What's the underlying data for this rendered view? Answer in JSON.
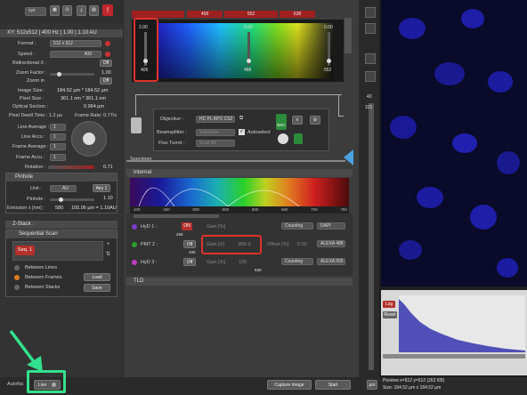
{
  "toolbar": {
    "dropdown": "xyz",
    "red_icon_label": "!"
  },
  "scan_header": {
    "title": "XY: 512x512 | 400 Hz | 1.00 | 1.10 AU"
  },
  "scan": {
    "format_label": "Format :",
    "format_value": "512 x 512",
    "speed_label": "Speed :",
    "speed_value": "400",
    "bidirectional_label": "Bidirectional X :",
    "bidirectional_value": "Off",
    "zoom_factor_label": "Zoom Factor :",
    "zoom_factor_value": "1.00",
    "zoom_in_label": "Zoom in",
    "zoom_in_value": "Off",
    "image_size_label": "Image Size :",
    "image_size_value": "184.52 µm * 184.52 µm",
    "pixel_size_label": "Pixel Size :",
    "pixel_size_value": "361.1 nm * 361.1 nm",
    "optical_section_label": "Optical Section :",
    "optical_section_value": "0.964 µm",
    "pixel_dwell_label": "Pixel Dwell Time : 1.2 µs",
    "frame_rate_label": "Frame Rate: 0.77/s",
    "line_average_label": "Line Average :",
    "line_average_value": "1",
    "line_accu_label": "Line Accu :",
    "line_accu_value": "1",
    "frame_average_label": "Frame Average :",
    "frame_average_value": "1",
    "frame_accu_label": "Frame Accu :",
    "frame_accu_value": "1",
    "rotation_label": "Rotation :",
    "rotation_value": "0.71"
  },
  "pinhole": {
    "title": "Pinhole",
    "unit_label": "Unit :",
    "unit_value": "AU",
    "airy_button": "Airy 1",
    "pinhole_label": "Pinhole :",
    "pinhole_value": "1.10",
    "emission_label": "Emission λ [nm] :",
    "emission_value": "580",
    "emission_info": "105.06 µm = 1.10AU"
  },
  "zstack": {
    "title": "Z-Stack :"
  },
  "sequential": {
    "title": "Sequential Scan",
    "seq_item": "Seq. 1",
    "between_lines": "Between Lines",
    "between_frames": "Between Frames",
    "between_stacks": "Between Stacks",
    "load_button": "Load",
    "save_button": "Save"
  },
  "laser": {
    "tabs": [
      "405",
      "458",
      "552",
      "638"
    ],
    "channels": [
      {
        "value": "2.00",
        "wavelength": "405"
      },
      {
        "value": "0.00",
        "wavelength": "488"
      },
      {
        "value": "0.00",
        "wavelength": "552"
      }
    ]
  },
  "beampath": {
    "objective_label": "Objective :",
    "objective_value": "HC PL APO CS2 63x",
    "beamsplitter_label": "Beamsplitter :",
    "beamsplitter_value": "Substrate",
    "autoselect_label": "Autoselect",
    "fluo_turret_label": "Fluo Turret :",
    "fluo_turret_value": "Scan-BF",
    "bsc_label": "BSC",
    "specimen_label": "Specimen"
  },
  "internal": {
    "title": "Internal",
    "axis_ticks": [
      "400",
      "450",
      "500",
      "550",
      "600",
      "650",
      "700",
      "750"
    ],
    "range_label_1": "415",
    "range_label_2": "465"
  },
  "detectors": [
    {
      "name": "HyD 1 :",
      "state": "ON",
      "gain_label": "Gain [%]",
      "gain_value": "",
      "mode": "Counting",
      "dye": "DAPI",
      "color": "#7a3cc8"
    },
    {
      "name": "PMT 2 :",
      "state": "Off",
      "gain_label": "Gain [V]",
      "gain_value": "800.0",
      "offset_label": "Offset [%]",
      "offset_value": "0.00",
      "dye": "ALEXA 488",
      "color": "#2aa02a"
    },
    {
      "name": "HyD 3 :",
      "state": "Off",
      "gain_label": "Gain [%]",
      "gain_value": "100",
      "mode": "Counting",
      "dye": "ALEXA 555",
      "color": "#c03cc0"
    }
  ],
  "detector_misc": {
    "range_a": "490",
    "range_b": "630"
  },
  "tld": {
    "title": "TLD"
  },
  "bottom": {
    "autofocus": "Autofoc",
    "live_button": "Live",
    "capture_button": "Capture Image",
    "start_button": "Start"
  },
  "right": {
    "slider_value": "43",
    "slider_max": "115",
    "log_button": "Log",
    "reset_button": "Reset",
    "preview_info": "Preview x=512 y=512 (262 KB)",
    "size_info": "Size: 184.52 µm x 184.52 µm",
    "side_button": "µm"
  }
}
